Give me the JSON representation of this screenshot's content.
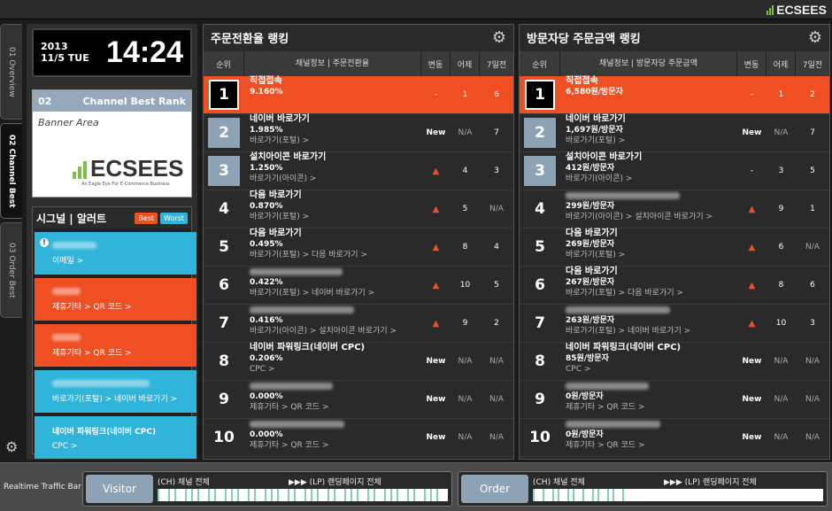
{
  "brand": "ECSEES",
  "side_tabs": [
    "01 Overview",
    "02 Channel Best",
    "03 Order Best"
  ],
  "clock": {
    "date_line1": "2013",
    "date_line2": "11/5 TUE",
    "time": "14:24"
  },
  "channel_best": {
    "num": "02",
    "title": "Channel Best Rank",
    "banner": "Banner Area",
    "logo_text": "ECSEES",
    "tagline": "An Eagle Eye For E-Commerce Business"
  },
  "signal": {
    "title": "시그널 | 알러트",
    "best": "Best",
    "worst": "Worst",
    "items": [
      {
        "color": "blue",
        "sub": "이메일 >"
      },
      {
        "color": "red",
        "sub": "제휴기타 > QR 코드 >"
      },
      {
        "color": "red",
        "sub": "제휴기타 > QR 코드 >"
      },
      {
        "color": "blue",
        "sub": "바로가기(포털) > 네이버 바로가기 >"
      },
      {
        "color": "blue",
        "title": "네이버 파워링크(네이버 CPC)",
        "sub": "CPC >"
      }
    ]
  },
  "panel1": {
    "title": "주문전환율 랭킹",
    "headers": [
      "순위",
      "채널정보 | 주문전환율",
      "변동",
      "어제",
      "7일전"
    ],
    "rows": [
      {
        "rank": "1",
        "name": "직접접속",
        "value": "9.160%",
        "sub": "",
        "chg": "-",
        "yd": "1",
        "d7": "6"
      },
      {
        "rank": "2",
        "name": "네이버 바로가기",
        "value": "1.985%",
        "sub": "바로가기(포털) >",
        "chg": "New",
        "yd": "N/A",
        "d7": "7"
      },
      {
        "rank": "3",
        "name": "설치아이콘 바로가기",
        "value": "1.250%",
        "sub": "바로가기(아이콘) >",
        "chg": "▲",
        "yd": "4",
        "d7": "3"
      },
      {
        "rank": "4",
        "name": "다음 바로가기",
        "value": "0.870%",
        "sub": "바로가기(포털) >",
        "chg": "▲",
        "yd": "5",
        "d7": "N/A"
      },
      {
        "rank": "5",
        "name": "다음 바로가기",
        "value": "0.495%",
        "sub": "바로가기(포털) > 다음 바로가기 >",
        "chg": "▲",
        "yd": "8",
        "d7": "4"
      },
      {
        "rank": "6",
        "name": "",
        "value": "0.422%",
        "sub": "바로가기(포털) > 네이버 바로가기 >",
        "chg": "▲",
        "yd": "10",
        "d7": "5"
      },
      {
        "rank": "7",
        "name": "",
        "value": "0.416%",
        "sub": "바로가기(아이콘) > 설치아이콘 바로가기 >",
        "chg": "▲",
        "yd": "9",
        "d7": "2"
      },
      {
        "rank": "8",
        "name": "네이버 파워링크(네이버 CPC)",
        "value": "0.206%",
        "sub": "CPC >",
        "chg": "New",
        "yd": "N/A",
        "d7": "N/A"
      },
      {
        "rank": "9",
        "name": "",
        "value": "0.000%",
        "sub": "제휴기타 > QR 코드 >",
        "chg": "New",
        "yd": "N/A",
        "d7": "N/A"
      },
      {
        "rank": "10",
        "name": "",
        "value": "0.000%",
        "sub": "제휴기타 > QR 코드 >",
        "chg": "New",
        "yd": "N/A",
        "d7": "N/A"
      }
    ]
  },
  "panel2": {
    "title": "방문자당 주문금액 랭킹",
    "headers": [
      "순위",
      "채널정보 | 방문자당 주문금액",
      "변동",
      "어제",
      "7일전"
    ],
    "rows": [
      {
        "rank": "1",
        "name": "직접접속",
        "value": "6,580원/방문자",
        "sub": "",
        "chg": "-",
        "yd": "1",
        "d7": "2"
      },
      {
        "rank": "2",
        "name": "네이버 바로가기",
        "value": "1,697원/방문자",
        "sub": "바로가기(포털) >",
        "chg": "New",
        "yd": "N/A",
        "d7": "7"
      },
      {
        "rank": "3",
        "name": "설치아이콘 바로가기",
        "value": "412원/방문자",
        "sub": "바로가기(아이콘) >",
        "chg": "-",
        "yd": "3",
        "d7": "5"
      },
      {
        "rank": "4",
        "name": "",
        "value": "299원/방문자",
        "sub": "바로가기(아이콘) > 설치아이콘 바로가기 >",
        "chg": "▲",
        "yd": "9",
        "d7": "1"
      },
      {
        "rank": "5",
        "name": "다음 바로가기",
        "value": "269원/방문자",
        "sub": "바로가기(포털) >",
        "chg": "▲",
        "yd": "6",
        "d7": "N/A"
      },
      {
        "rank": "6",
        "name": "다음 바로가기",
        "value": "267원/방문자",
        "sub": "바로가기(포털) > 다음 바로가기 >",
        "chg": "▲",
        "yd": "8",
        "d7": "6"
      },
      {
        "rank": "7",
        "name": "",
        "value": "263원/방문자",
        "sub": "바로가기(포털) > 네이버 바로가기 >",
        "chg": "▲",
        "yd": "10",
        "d7": "3"
      },
      {
        "rank": "8",
        "name": "네이버 파워링크(네이버 CPC)",
        "value": "85원/방문자",
        "sub": "CPC >",
        "chg": "New",
        "yd": "N/A",
        "d7": "N/A"
      },
      {
        "rank": "9",
        "name": "",
        "value": "0원/방문자",
        "sub": "제휴기타 > QR 코드 >",
        "chg": "New",
        "yd": "N/A",
        "d7": "N/A"
      },
      {
        "rank": "10",
        "name": "",
        "value": "0원/방문자",
        "sub": "제휴기타 > QR 코드 >",
        "chg": "New",
        "yd": "N/A",
        "d7": "N/A"
      }
    ]
  },
  "footer": {
    "label": "Realtime Traffic Bar",
    "visitor": {
      "button": "Visitor",
      "left": "(CH) 채널 전체",
      "right": "▶▶▶ (LP) 랜딩페이지 전체"
    },
    "order": {
      "button": "Order",
      "left": "(CH) 채널 전체",
      "right": "▶▶▶ (LP) 랜딩페이지 전체"
    }
  },
  "colors": {
    "accent_red": "#f04e23",
    "accent_blue": "#31b4d9",
    "rank_gray": "#8ea2b6",
    "brand_green": "#7cc242"
  }
}
